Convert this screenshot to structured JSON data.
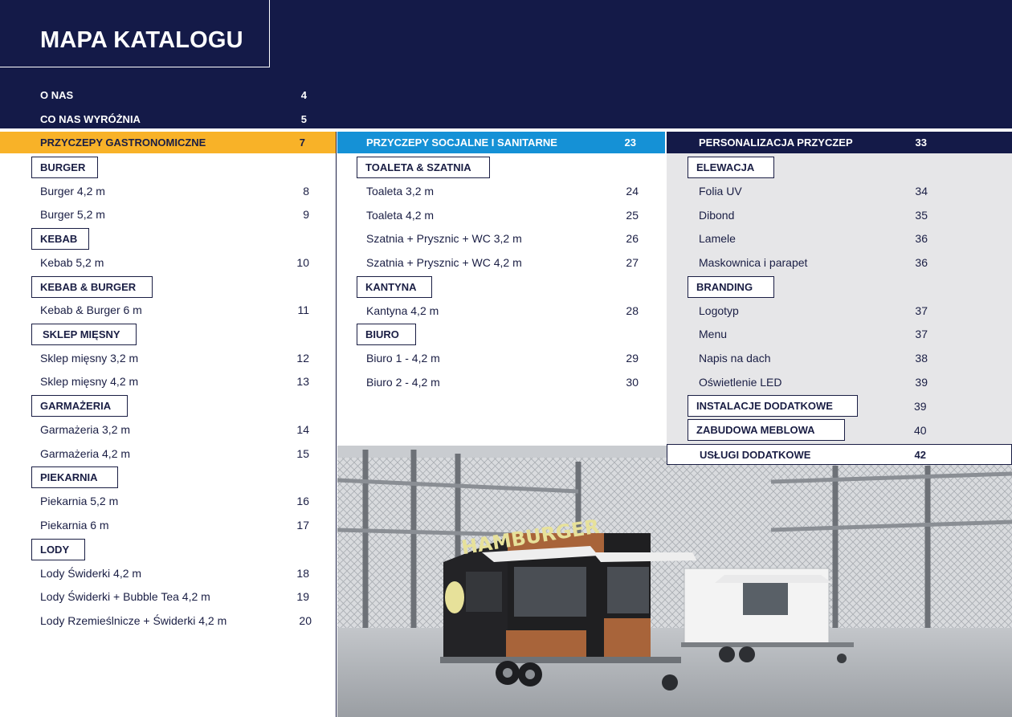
{
  "title": "MAPA KATALOGU",
  "intro": [
    {
      "label": "O NAS",
      "page": "4"
    },
    {
      "label": "CO NAS WYRÓŻNIA",
      "page": "5"
    }
  ],
  "col1": {
    "category": {
      "label": "PRZYCZEPY GASTRONOMICZNE",
      "page": "7"
    },
    "groups": [
      {
        "title": "BURGER",
        "items": [
          {
            "label": "Burger 4,2 m",
            "page": "8"
          },
          {
            "label": "Burger 5,2 m",
            "page": "9"
          }
        ]
      },
      {
        "title": "KEBAB",
        "items": [
          {
            "label": "Kebab 5,2 m",
            "page": "10"
          }
        ]
      },
      {
        "title": "KEBAB & BURGER",
        "items": [
          {
            "label": "Kebab & Burger 6 m",
            "page": "11"
          }
        ]
      },
      {
        "title": "SKLEP MIĘSNY",
        "items": [
          {
            "label": "Sklep mięsny 3,2 m",
            "page": "12"
          },
          {
            "label": "Sklep mięsny 4,2 m",
            "page": "13"
          }
        ]
      },
      {
        "title": "GARMAŻERIA",
        "items": [
          {
            "label": "Garmażeria 3,2 m",
            "page": "14"
          },
          {
            "label": "Garmażeria 4,2 m",
            "page": "15"
          }
        ]
      },
      {
        "title": "PIEKARNIA",
        "items": [
          {
            "label": "Piekarnia 5,2 m",
            "page": "16"
          },
          {
            "label": "Piekarnia 6 m",
            "page": "17"
          }
        ]
      },
      {
        "title": "LODY",
        "items": [
          {
            "label": "Lody Świderki 4,2 m",
            "page": "18"
          },
          {
            "label": "Lody Świderki + Bubble Tea 4,2 m",
            "page": "19"
          },
          {
            "label": "Lody Rzemieślnicze + Świderki 4,2 m",
            "page": "20"
          }
        ]
      }
    ]
  },
  "col2": {
    "category": {
      "label": "PRZYCZEPY SOCJALNE I SANITARNE",
      "page": "23"
    },
    "groups": [
      {
        "title": "TOALETA & SZATNIA",
        "items": [
          {
            "label": "Toaleta 3,2 m",
            "page": "24"
          },
          {
            "label": "Toaleta 4,2 m",
            "page": "25"
          },
          {
            "label": "Szatnia + Prysznic + WC 3,2 m",
            "page": "26"
          },
          {
            "label": "Szatnia + Prysznic + WC 4,2 m",
            "page": "27"
          }
        ]
      },
      {
        "title": "KANTYNA",
        "items": [
          {
            "label": "Kantyna 4,2 m",
            "page": "28"
          }
        ]
      },
      {
        "title": "BIURO",
        "items": [
          {
            "label": "Biuro 1 - 4,2 m",
            "page": "29"
          },
          {
            "label": "Biuro 2 - 4,2 m",
            "page": "30"
          }
        ]
      }
    ]
  },
  "col3": {
    "category": {
      "label": "PERSONALIZACJA PRZYCZEP",
      "page": "33"
    },
    "groups": [
      {
        "title": "ELEWACJA",
        "items": [
          {
            "label": "Folia UV",
            "page": "34"
          },
          {
            "label": "Dibond",
            "page": "35"
          },
          {
            "label": "Lamele",
            "page": "36"
          },
          {
            "label": "Maskownica i parapet",
            "page": "36"
          }
        ]
      },
      {
        "title": "BRANDING",
        "items": [
          {
            "label": "Logotyp",
            "page": "37"
          },
          {
            "label": "Menu",
            "page": "37"
          },
          {
            "label": "Napis na dach",
            "page": "38"
          },
          {
            "label": "Oświetlenie LED",
            "page": "39"
          }
        ]
      }
    ],
    "extras": [
      {
        "title": "INSTALACJE DODATKOWE",
        "page": "39"
      },
      {
        "title": "ZABUDOWA MEBLOWA",
        "page": "40"
      }
    ],
    "uslugi": {
      "label": "USŁUGI DODATKOWE",
      "page": "42"
    }
  },
  "photo": {
    "sign": "HAMBURGER",
    "colors": {
      "floor": "#b9bcc0",
      "wall": "#c9ccd0",
      "truck_black": "#222224",
      "wood": "#a8643a",
      "sign": "#e7e19a"
    }
  }
}
